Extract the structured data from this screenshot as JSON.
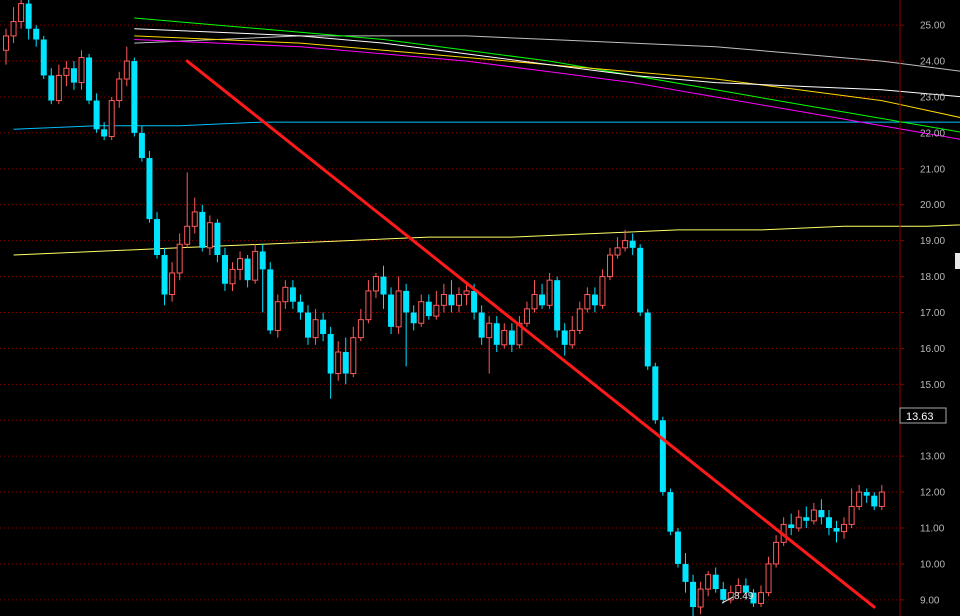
{
  "chart_data": {
    "type": "candlestick",
    "ylim": [
      8.55,
      25.7
    ],
    "yticks": [
      "25.00",
      "24.00",
      "23.00",
      "22.00",
      "21.00",
      "20.00",
      "19.00",
      "18.00",
      "17.00",
      "16.00",
      "15.00",
      "14.00",
      "13.00",
      "12.00",
      "11.00",
      "10.00",
      "9.00"
    ],
    "grid": "horizontal-dotted",
    "current_price": "13.63",
    "low_annotation": "8.49",
    "colors": {
      "background": "#000000",
      "up": "#ff5a5a",
      "down": "#00e5ff",
      "grid": "#8b0000",
      "trendline": "#ff1a1a",
      "ma5": "#ffffff",
      "ma10": "#ffd700",
      "ma20": "#ff00ff",
      "ma30": "#00ff00",
      "ma60": "#c0c0c0",
      "ma120": "#00bfff",
      "ma250": "#ffff66"
    },
    "candles": [
      [
        24.3,
        24.7,
        24.9,
        23.9
      ],
      [
        24.7,
        25.1,
        25.5,
        24.5
      ],
      [
        25.1,
        25.6,
        25.8,
        24.9
      ],
      [
        25.6,
        24.9,
        25.9,
        24.6
      ],
      [
        24.9,
        24.6,
        25.0,
        24.4
      ],
      [
        24.6,
        23.6,
        24.7,
        23.5
      ],
      [
        23.6,
        22.9,
        23.8,
        22.8
      ],
      [
        22.9,
        23.6,
        23.9,
        22.8
      ],
      [
        23.6,
        23.8,
        24.0,
        23.3
      ],
      [
        23.8,
        23.4,
        24.0,
        23.2
      ],
      [
        23.4,
        24.1,
        24.3,
        23.2
      ],
      [
        24.1,
        22.9,
        24.2,
        22.8
      ],
      [
        22.9,
        22.1,
        23.1,
        22.0
      ],
      [
        22.1,
        21.9,
        22.3,
        21.8
      ],
      [
        21.9,
        22.9,
        23.0,
        21.8
      ],
      [
        22.9,
        23.5,
        23.7,
        22.7
      ],
      [
        23.5,
        24.0,
        24.4,
        23.3
      ],
      [
        24.0,
        22.0,
        24.1,
        21.9
      ],
      [
        22.0,
        21.3,
        22.2,
        21.2
      ],
      [
        21.3,
        19.6,
        21.5,
        19.5
      ],
      [
        19.6,
        18.6,
        19.8,
        18.5
      ],
      [
        18.6,
        17.5,
        18.8,
        17.2
      ],
      [
        17.5,
        18.1,
        18.4,
        17.3
      ],
      [
        18.1,
        18.9,
        19.2,
        17.9
      ],
      [
        18.9,
        19.4,
        20.9,
        18.8
      ],
      [
        19.4,
        19.8,
        20.2,
        19.2
      ],
      [
        19.8,
        18.8,
        20.0,
        18.7
      ],
      [
        18.8,
        19.5,
        19.7,
        18.6
      ],
      [
        19.5,
        18.6,
        19.6,
        18.4
      ],
      [
        18.6,
        17.8,
        18.8,
        17.6
      ],
      [
        17.8,
        18.2,
        18.4,
        17.6
      ],
      [
        18.2,
        18.5,
        18.7,
        17.9
      ],
      [
        18.5,
        17.9,
        18.6,
        17.7
      ],
      [
        17.9,
        18.7,
        18.9,
        17.8
      ],
      [
        18.7,
        18.2,
        18.9,
        17.0
      ],
      [
        18.2,
        16.5,
        18.4,
        16.4
      ],
      [
        16.5,
        17.3,
        17.5,
        16.3
      ],
      [
        17.3,
        17.7,
        17.9,
        17.1
      ],
      [
        17.7,
        17.3,
        17.9,
        17.1
      ],
      [
        17.3,
        17.0,
        17.5,
        16.8
      ],
      [
        17.0,
        16.3,
        17.2,
        16.1
      ],
      [
        16.3,
        16.8,
        17.1,
        16.1
      ],
      [
        16.8,
        16.4,
        17.0,
        16.2
      ],
      [
        16.4,
        15.3,
        16.6,
        14.6
      ],
      [
        15.3,
        15.9,
        16.2,
        15.1
      ],
      [
        15.9,
        15.3,
        16.3,
        15.0
      ],
      [
        15.3,
        16.3,
        16.6,
        15.2
      ],
      [
        16.3,
        16.8,
        17.1,
        16.2
      ],
      [
        16.8,
        17.6,
        17.9,
        16.7
      ],
      [
        17.6,
        18.0,
        18.1,
        17.4
      ],
      [
        18.0,
        17.5,
        18.3,
        17.1
      ],
      [
        17.5,
        16.6,
        17.7,
        16.4
      ],
      [
        16.6,
        17.6,
        18.0,
        16.4
      ],
      [
        17.6,
        17.0,
        17.8,
        15.5
      ],
      [
        17.0,
        16.7,
        17.2,
        16.5
      ],
      [
        16.7,
        17.3,
        17.5,
        16.6
      ],
      [
        17.3,
        16.9,
        17.5,
        16.8
      ],
      [
        16.9,
        17.2,
        17.6,
        16.8
      ],
      [
        17.2,
        17.5,
        17.8,
        17.0
      ],
      [
        17.5,
        17.2,
        17.9,
        17.0
      ],
      [
        17.2,
        17.5,
        17.7,
        17.0
      ],
      [
        17.5,
        17.6,
        17.8,
        17.2
      ],
      [
        17.6,
        17.0,
        17.8,
        16.8
      ],
      [
        17.0,
        16.3,
        17.2,
        16.1
      ],
      [
        16.3,
        16.7,
        16.9,
        15.3
      ],
      [
        16.7,
        16.1,
        16.9,
        15.9
      ],
      [
        16.1,
        16.5,
        16.7,
        16.0
      ],
      [
        16.5,
        16.1,
        16.7,
        15.9
      ],
      [
        16.1,
        16.7,
        16.9,
        16.0
      ],
      [
        16.7,
        17.1,
        17.3,
        16.6
      ],
      [
        17.1,
        17.5,
        17.9,
        17.0
      ],
      [
        17.5,
        17.2,
        17.8,
        17.1
      ],
      [
        17.2,
        17.9,
        18.1,
        17.1
      ],
      [
        17.9,
        16.5,
        18.0,
        16.3
      ],
      [
        16.5,
        16.1,
        16.7,
        15.8
      ],
      [
        16.1,
        16.5,
        16.9,
        16.0
      ],
      [
        16.5,
        17.1,
        17.3,
        16.4
      ],
      [
        17.1,
        17.5,
        17.7,
        17.0
      ],
      [
        17.5,
        17.2,
        17.7,
        17.0
      ],
      [
        17.2,
        18.0,
        18.2,
        17.1
      ],
      [
        18.0,
        18.6,
        18.8,
        17.9
      ],
      [
        18.6,
        18.8,
        19.1,
        18.5
      ],
      [
        18.8,
        19.0,
        19.3,
        18.7
      ],
      [
        19.0,
        18.8,
        19.2,
        18.6
      ],
      [
        18.8,
        17.0,
        18.9,
        16.9
      ],
      [
        17.0,
        15.5,
        17.1,
        15.4
      ],
      [
        15.5,
        14.0,
        15.6,
        13.9
      ],
      [
        14.0,
        12.0,
        14.1,
        11.9
      ],
      [
        12.0,
        10.9,
        12.1,
        10.8
      ],
      [
        10.9,
        10.0,
        11.0,
        9.9
      ],
      [
        10.0,
        9.5,
        10.3,
        9.2
      ],
      [
        9.5,
        8.8,
        9.7,
        8.5
      ],
      [
        8.8,
        9.3,
        9.5,
        8.6
      ],
      [
        9.3,
        9.7,
        9.8,
        9.1
      ],
      [
        9.7,
        9.3,
        9.9,
        9.2
      ],
      [
        9.3,
        9.0,
        9.5,
        8.9
      ],
      [
        9.0,
        9.2,
        9.4,
        8.9
      ],
      [
        9.2,
        9.4,
        9.6,
        9.1
      ],
      [
        9.4,
        9.2,
        9.6,
        9.0
      ],
      [
        9.2,
        8.9,
        9.3,
        8.8
      ],
      [
        8.9,
        9.2,
        9.4,
        8.8
      ],
      [
        9.2,
        10.0,
        10.2,
        9.1
      ],
      [
        10.0,
        10.6,
        10.8,
        9.9
      ],
      [
        10.6,
        11.1,
        11.3,
        10.5
      ],
      [
        11.1,
        11.0,
        11.4,
        10.8
      ],
      [
        11.0,
        11.3,
        11.5,
        10.9
      ],
      [
        11.3,
        11.2,
        11.6,
        11.0
      ],
      [
        11.2,
        11.5,
        11.7,
        11.1
      ],
      [
        11.5,
        11.3,
        11.8,
        11.1
      ],
      [
        11.3,
        11.0,
        11.5,
        10.8
      ],
      [
        11.0,
        10.9,
        11.2,
        10.6
      ],
      [
        10.9,
        11.1,
        11.3,
        10.7
      ],
      [
        11.1,
        11.6,
        12.1,
        11.0
      ],
      [
        11.6,
        12.0,
        12.2,
        11.5
      ],
      [
        12.0,
        11.9,
        12.1,
        11.7
      ],
      [
        11.9,
        11.6,
        12.0,
        11.5
      ],
      [
        11.6,
        12.0,
        12.2,
        11.5
      ]
    ],
    "moving_averages": [
      {
        "key": "ma5",
        "start": 17.0,
        "dx": 11,
        "v": [
          24.9,
          24.8,
          24.7,
          24.5,
          24.2,
          23.9,
          23.6,
          23.4,
          23.3,
          23.2,
          23.0,
          22.8,
          22.4,
          21.6,
          20.5,
          19.5,
          18.8,
          18.5,
          18.6,
          18.9,
          18.8,
          18.4,
          18.1,
          17.9,
          17.6,
          17.2,
          16.7,
          16.4,
          16.6,
          17.2,
          17.4,
          17.3,
          17.1,
          16.9,
          16.6,
          16.5,
          16.6,
          16.8,
          17.0,
          17.2,
          17.4,
          17.7,
          18.1,
          18.4,
          18.1,
          17.0,
          14.5,
          12.0,
          10.2,
          9.5,
          9.3,
          9.2,
          9.3,
          9.4,
          9.6,
          10.1,
          10.6,
          10.9,
          11.0,
          11.1,
          11.2,
          11.4,
          11.6,
          11.8
        ]
      },
      {
        "key": "ma10",
        "start": 17.0,
        "dx": 11,
        "v": [
          24.7,
          24.6,
          24.5,
          24.3,
          24.1,
          23.9,
          23.7,
          23.5,
          23.2,
          22.9,
          22.4,
          21.8,
          21.0,
          20.2,
          19.5,
          19.2,
          19.0,
          18.8,
          18.6,
          18.4,
          18.2,
          17.9,
          17.6,
          17.3,
          17.0,
          16.7,
          16.5,
          16.6,
          16.9,
          17.1,
          17.2,
          17.2,
          17.1,
          17.0,
          16.9,
          16.8,
          16.8,
          16.9,
          17.0,
          17.2,
          17.3,
          17.4,
          17.4,
          17.4,
          17.2,
          16.5,
          15.0,
          13.5,
          12.0,
          10.9,
          10.0,
          9.6,
          9.4,
          9.3,
          9.4,
          9.6,
          9.9,
          10.2,
          10.5,
          10.7,
          10.9,
          11.1,
          11.3,
          11.5
        ]
      },
      {
        "key": "ma20",
        "start": 17.0,
        "dx": 11,
        "v": [
          24.6,
          24.5,
          24.4,
          24.2,
          24.0,
          23.7,
          23.4,
          23.0,
          22.6,
          22.2,
          21.8,
          21.4,
          21.0,
          20.6,
          20.2,
          19.8,
          19.4,
          19.0,
          18.7,
          18.4,
          18.2,
          18.0,
          17.8,
          17.6,
          17.4,
          17.2,
          17.0,
          16.9,
          16.9,
          17.0,
          17.0,
          17.0,
          17.0,
          16.9,
          16.9,
          16.9,
          16.9,
          17.0,
          17.0,
          17.1,
          17.1,
          17.2,
          17.2,
          17.2,
          17.0,
          16.6,
          15.8,
          14.8,
          13.7,
          12.6,
          11.6,
          10.8,
          10.3,
          10.0,
          9.8,
          9.8,
          9.9,
          10.0,
          10.1,
          10.2,
          10.3,
          10.4,
          10.5,
          10.6
        ]
      },
      {
        "key": "ma30",
        "start": 17.0,
        "dx": 11,
        "v": [
          25.2,
          25.0,
          24.8,
          24.6,
          24.3,
          24.0,
          23.6,
          23.2,
          22.8,
          22.4,
          22.0,
          21.6,
          21.2,
          20.8,
          20.4,
          20.0,
          19.6,
          19.2,
          18.8,
          18.4,
          18.0,
          17.7,
          17.5,
          17.4,
          17.3,
          17.3,
          17.3,
          17.3,
          17.3,
          17.2,
          17.2,
          17.1,
          17.1,
          17.1,
          17.1,
          17.1,
          17.1,
          17.1,
          17.1,
          17.2,
          17.2,
          17.2,
          17.1,
          17.0,
          16.8,
          16.4,
          15.8,
          15.1,
          14.4,
          13.7,
          13.1,
          12.6,
          12.1,
          11.7,
          11.4,
          11.2,
          11.0,
          10.9,
          10.9,
          10.9,
          10.9,
          10.9,
          10.8,
          10.7
        ]
      },
      {
        "key": "ma60",
        "start": 17.0,
        "dx": 11,
        "v": [
          24.5,
          24.6,
          24.7,
          24.7,
          24.7,
          24.6,
          24.5,
          24.4,
          24.2,
          24.0,
          23.7,
          23.4,
          23.1,
          22.8,
          22.4,
          22.1,
          21.8,
          21.4,
          21.1,
          20.8,
          20.4,
          20.1,
          19.8,
          19.5,
          19.2,
          18.9,
          18.7,
          18.5,
          18.3,
          18.2,
          18.1,
          18.0,
          17.9,
          17.8,
          17.7,
          17.6,
          17.5,
          17.5,
          17.4,
          17.3,
          17.3,
          17.3,
          17.3,
          17.3,
          17.2,
          17.1,
          16.9,
          16.6,
          16.3,
          16.0,
          15.7,
          15.5,
          15.3,
          15.1,
          14.9,
          14.7,
          14.6,
          14.5,
          14.4,
          14.3,
          14.2,
          14.0,
          13.9,
          13.8
        ]
      },
      {
        "key": "ma120",
        "start": 1.0,
        "dx": 11,
        "v": [
          22.1,
          22.2,
          22.2,
          22.3,
          22.3,
          22.3,
          22.3,
          22.3,
          22.3,
          22.3,
          22.3,
          22.3,
          22.3,
          22.3,
          22.3,
          22.3,
          22.3,
          22.3,
          22.2,
          22.2,
          22.2,
          22.2,
          22.1,
          22.1,
          22.1,
          22.1,
          22.0,
          22.0,
          22.0,
          21.9,
          21.9,
          21.8,
          21.8,
          21.7,
          21.6,
          21.6,
          21.5,
          21.5,
          21.4,
          21.3,
          21.3,
          21.2,
          21.1,
          21.0,
          21.0,
          20.9,
          20.8,
          20.7,
          20.6,
          20.4,
          20.3,
          20.1,
          19.9,
          19.7,
          19.5,
          19.3,
          19.1,
          18.9,
          18.6,
          18.4,
          18.2,
          18.0,
          17.8,
          17.6,
          17.4,
          17.3,
          17.2
        ]
      },
      {
        "key": "ma250",
        "start": 1.0,
        "dx": 11,
        "v": [
          18.6,
          18.7,
          18.8,
          18.9,
          19.0,
          19.1,
          19.1,
          19.2,
          19.3,
          19.3,
          19.4,
          19.4,
          19.5,
          19.5,
          19.5,
          19.6,
          19.6,
          19.6,
          19.7,
          19.7,
          19.7,
          19.7,
          19.8,
          19.8,
          19.8,
          19.8,
          19.8,
          19.9,
          19.9,
          19.9,
          19.9,
          19.9,
          19.9,
          19.9,
          19.9,
          19.9,
          19.9,
          19.9,
          19.9,
          19.9,
          19.9,
          20.0,
          20.0,
          20.0,
          20.0,
          20.0,
          20.0,
          19.9,
          19.9,
          19.8,
          19.8,
          19.7,
          19.7,
          19.6,
          19.6,
          19.5,
          19.5,
          19.5,
          19.4,
          19.4,
          19.4,
          19.3,
          19.3,
          19.3,
          19.3,
          19.2,
          19.2
        ]
      }
    ],
    "trendline": {
      "from": [
        24.0,
        24.0
      ],
      "to": [
        115.0,
        8.8
      ]
    }
  }
}
